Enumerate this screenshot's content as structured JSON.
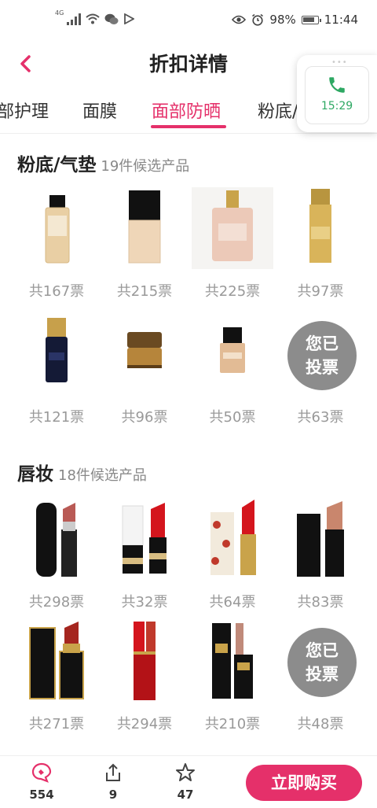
{
  "status_bar": {
    "battery": "98%",
    "time": "11:44",
    "network": "4G"
  },
  "header": {
    "title": "折扣详情"
  },
  "call_widget": {
    "time": "15:29"
  },
  "tabs": [
    {
      "label": "部护理"
    },
    {
      "label": "面膜"
    },
    {
      "label": "面部防晒"
    },
    {
      "label": "粉底/"
    }
  ],
  "sections": [
    {
      "title": "粉底/气垫",
      "subtitle": "19件候选产品",
      "products": [
        {
          "votes": "共167票"
        },
        {
          "votes": "共215票"
        },
        {
          "votes": "共225票"
        },
        {
          "votes": "共97票"
        },
        {
          "votes": "共121票"
        },
        {
          "votes": "共96票"
        },
        {
          "votes": "共50票"
        },
        {
          "votes": "共63票",
          "badge": "您已投票"
        }
      ]
    },
    {
      "title": "唇妆",
      "subtitle": "18件候选产品",
      "products": [
        {
          "votes": "共298票"
        },
        {
          "votes": "共32票"
        },
        {
          "votes": "共64票"
        },
        {
          "votes": "共83票"
        },
        {
          "votes": "共271票"
        },
        {
          "votes": "共294票"
        },
        {
          "votes": "共210票"
        },
        {
          "votes": "共48票",
          "badge": "您已投票"
        }
      ]
    }
  ],
  "bottom_bar": {
    "comments": "554",
    "shares": "9",
    "favorites": "47",
    "buy_label": "立即购买"
  },
  "colors": {
    "accent": "#e5306a",
    "call_green": "#2ea863"
  }
}
